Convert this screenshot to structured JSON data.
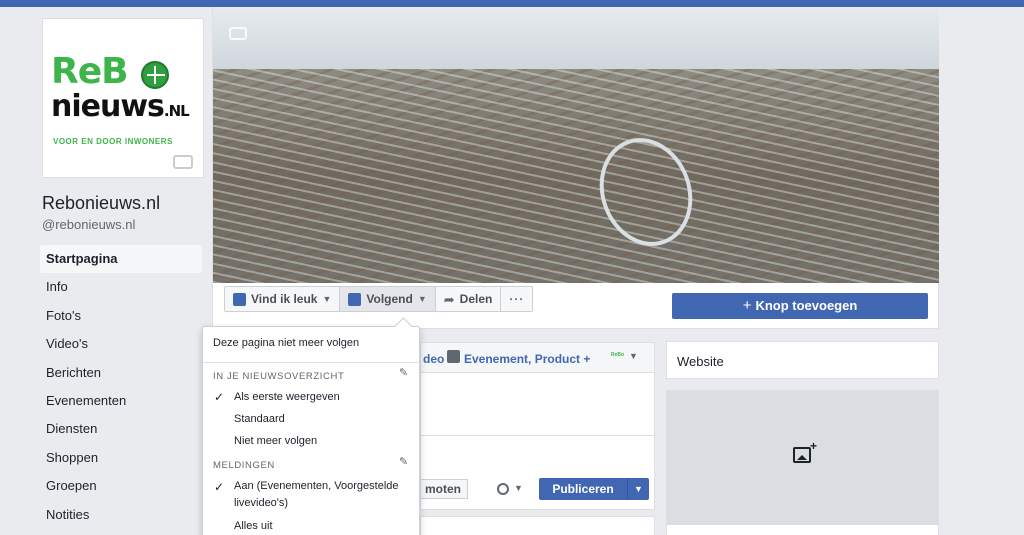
{
  "logo": {
    "brand_re": "ReB",
    "brand_nieuws": "nieuws",
    "brand_nl": ".NL",
    "tagline": "VOOR EN DOOR INWONERS"
  },
  "page": {
    "name": "Rebonieuws.nl",
    "handle": "@rebonieuws.nl"
  },
  "nav": {
    "items": [
      {
        "label": "Startpagina",
        "active": true
      },
      {
        "label": "Info"
      },
      {
        "label": "Foto's"
      },
      {
        "label": "Video's"
      },
      {
        "label": "Berichten"
      },
      {
        "label": "Evenementen"
      },
      {
        "label": "Diensten"
      },
      {
        "label": "Shoppen"
      },
      {
        "label": "Groepen"
      },
      {
        "label": "Notities"
      }
    ]
  },
  "actions": {
    "like": "Vind ik leuk",
    "follow": "Volgend",
    "share": "Delen",
    "more": "···",
    "add_button": "Knop toevoegen"
  },
  "composer": {
    "video": "deo",
    "event_product": "Evenement, Product +",
    "mini_logo": "ReBo",
    "moten": "moten",
    "publish": "Publiceren"
  },
  "right": {
    "website": "Website"
  },
  "follow_menu": {
    "unfollow_page": "Deze pagina niet meer volgen",
    "newsfeed_header": "IN JE NIEUWSOVERZICHT",
    "newsfeed_options": [
      {
        "label": "Als eerste weergeven",
        "checked": true
      },
      {
        "label": "Standaard"
      },
      {
        "label": "Niet meer volgen"
      }
    ],
    "notifications_header": "MELDINGEN",
    "notification_options": [
      {
        "label": "Aan (Evenementen, Voorgestelde livevideo's)",
        "checked": true
      },
      {
        "label": "Alles uit"
      }
    ]
  },
  "colors": {
    "fb_blue": "#4267b2",
    "brand_green": "#3db54a",
    "page_bg": "#e9ebee"
  }
}
